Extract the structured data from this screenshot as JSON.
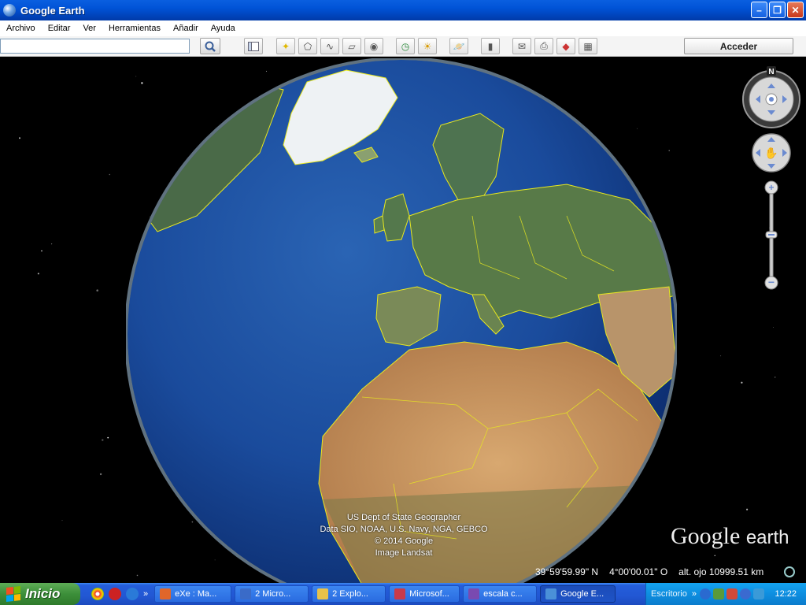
{
  "window": {
    "title": "Google Earth"
  },
  "menu": [
    "Archivo",
    "Editar",
    "Ver",
    "Herramientas",
    "Añadir",
    "Ayuda"
  ],
  "search": {
    "placeholder": "",
    "value": ""
  },
  "toolbar": {
    "login_label": "Acceder"
  },
  "nav": {
    "north_label": "N"
  },
  "attribution": [
    "US Dept of State Geographer",
    "Data SIO, NOAA, U.S. Navy, NGA, GEBCO",
    "© 2014 Google",
    "Image Landsat"
  ],
  "logo": {
    "google": "Google",
    "earth": "earth"
  },
  "status": {
    "lat": "39°59'59.99\" N",
    "lon": "4°00'00.01\" O",
    "alt": "alt. ojo 10999.51 km"
  },
  "taskbar": {
    "start_label": "Inicio",
    "tasks": [
      {
        "label": "eXe : Ma...",
        "color": "#e0662a"
      },
      {
        "label": "2 Micro...",
        "color": "#3a6bc8"
      },
      {
        "label": "2 Explo...",
        "color": "#e8c24a"
      },
      {
        "label": "Microsof...",
        "color": "#c83a4a"
      },
      {
        "label": "escala c...",
        "color": "#7a4ab0"
      },
      {
        "label": "Google E...",
        "color": "#4a90d8"
      }
    ],
    "tray_label": "Escritorio",
    "clock": "12:22"
  },
  "colors": {
    "border_yellow": "#e8e820",
    "ocean": "#1b4f9e"
  }
}
